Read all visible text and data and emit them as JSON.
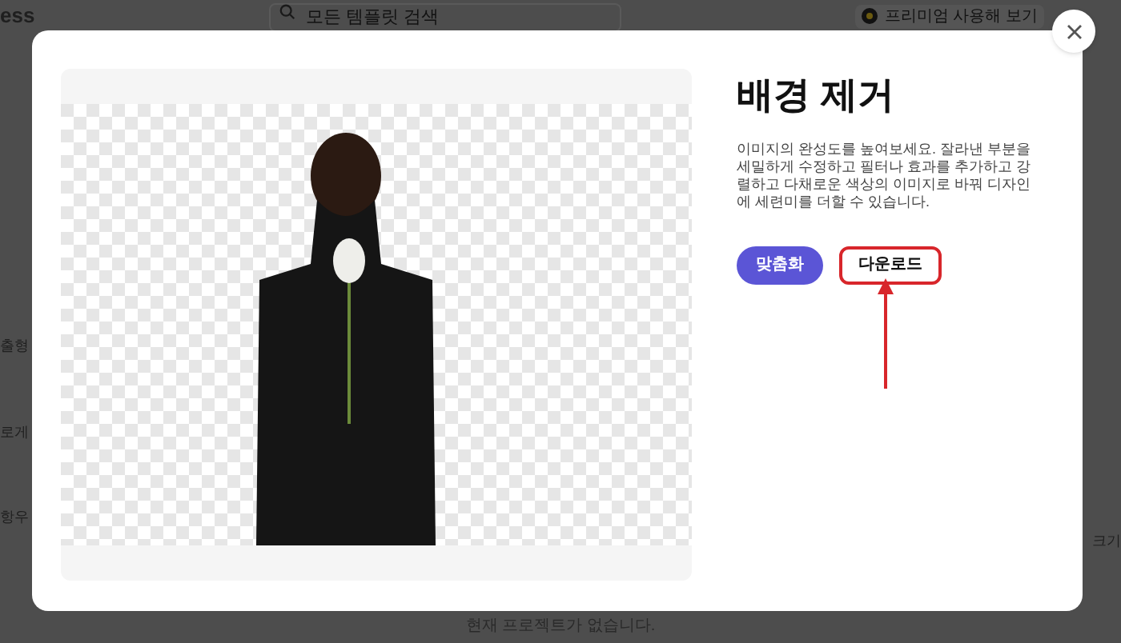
{
  "background_page": {
    "brand": "ess",
    "search": {
      "placeholder": "모든 템플릿 검색"
    },
    "premium_button": "프리미엄 사용해 보기",
    "left_fragments": [
      "출형",
      "로게",
      "항우"
    ],
    "right_fragment": "크기",
    "empty_message": "현재 프로젝트가 없습니다."
  },
  "modal": {
    "title": "배경 제거",
    "description": "이미지의 완성도를 높여보세요. 잘라낸 부분을 세밀하게 수정하고 필터나 효과를 추가하고 강렬하고 다채로운 색상의 이미지로 바꿔 디자인에 세련미를 더할 수 있습니다.",
    "buttons": [
      {
        "label": "맞춤화",
        "kind": "primary",
        "highlighted": false
      },
      {
        "label": "다운로드",
        "kind": "secondary",
        "highlighted": true
      }
    ],
    "annotation_arrow": true
  }
}
